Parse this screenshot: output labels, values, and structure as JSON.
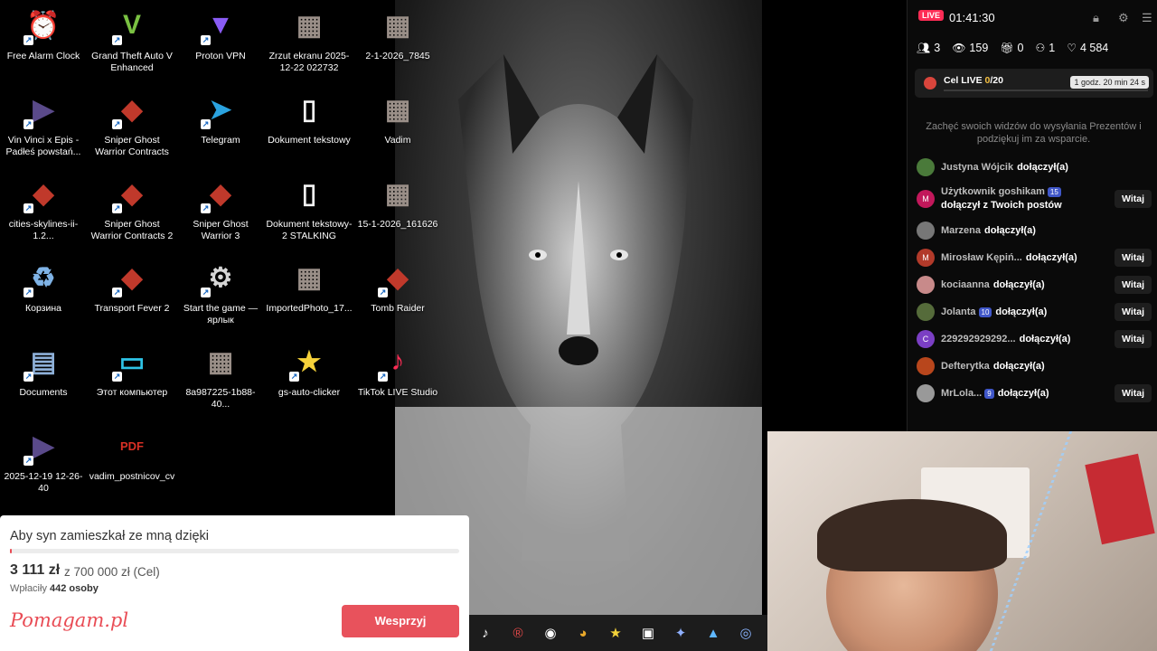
{
  "desktop": {
    "icons": [
      {
        "label": "Free Alarm Clock",
        "icon": "alarm-clock-icon"
      },
      {
        "label": "Grand Theft Auto V Enhanced",
        "icon": "gta-icon"
      },
      {
        "label": "Proton VPN",
        "icon": "vpn-icon"
      },
      {
        "label": "Zrzut ekranu 2025-12-22 022732",
        "icon": "image-icon"
      },
      {
        "label": "2-1-2026_7845",
        "icon": "image-icon"
      },
      {
        "label": "Vin Vinci x Epis - Padłeś powstań...",
        "icon": "video-icon"
      },
      {
        "label": "Sniper Ghost Warrior Contracts",
        "icon": "game-icon"
      },
      {
        "label": "Telegram",
        "icon": "telegram-icon"
      },
      {
        "label": "Dokument tekstowy",
        "icon": "document-icon"
      },
      {
        "label": "Vadim",
        "icon": "image-icon"
      },
      {
        "label": "cities-skylines-ii-1.2...",
        "icon": "game-icon"
      },
      {
        "label": "Sniper Ghost Warrior Contracts 2",
        "icon": "game-icon"
      },
      {
        "label": "Sniper Ghost Warrior 3",
        "icon": "game-icon"
      },
      {
        "label": "Dokument tekstowy-2 STALKING",
        "icon": "document-icon"
      },
      {
        "label": "15-1-2026_161626",
        "icon": "image-icon"
      },
      {
        "label": "Корзина",
        "icon": "recycle-bin-icon"
      },
      {
        "label": "Transport Fever 2",
        "icon": "game-icon"
      },
      {
        "label": "Start the game — ярлык",
        "icon": "shortcut-icon"
      },
      {
        "label": "ImportedPhoto_17...",
        "icon": "image-icon"
      },
      {
        "label": "Tomb Raider",
        "icon": "game-icon"
      },
      {
        "label": "Documents",
        "icon": "folder-icon"
      },
      {
        "label": "Этот компьютер",
        "icon": "computer-icon"
      },
      {
        "label": "8a987225-1b88-40...",
        "icon": "image-icon"
      },
      {
        "label": "gs-auto-clicker",
        "icon": "star-icon"
      },
      {
        "label": "TikTok LIVE Studio",
        "icon": "tiktok-icon"
      },
      {
        "label": "2025-12-19 12-26-40",
        "icon": "video-icon"
      },
      {
        "label": "vadim_postnicov_cv",
        "icon": "pdf-icon"
      }
    ]
  },
  "fundraiser": {
    "title": "Aby syn zamieszkał ze mną dzięki",
    "amount": "3 111 zł",
    "goal": "z 700 000 zł (Cel)",
    "payers_prefix": "Wpłaciły",
    "payers_count": "442 osoby",
    "logo": "Pomagam.pl",
    "button": "Wesprzyj",
    "progress": 0.0044,
    "accent": "#e8525c"
  },
  "live": {
    "badge": "LIVE",
    "timer": "01:41:30",
    "stats": {
      "guests": "3",
      "viewers": "159",
      "gifts": "0",
      "follows": "1",
      "likes": "4 584"
    },
    "goal": {
      "label": "Cel LIVE",
      "current": "0",
      "target": "/20",
      "time": "1 godz. 20 min 24 s"
    },
    "hint": "Zachęć swoich widzów do wysyłania Prezentów i podziękuj im za wsparcie.",
    "feed": [
      {
        "user": "Justyna Wójcik",
        "action": "dołączył(a)",
        "level": "",
        "witaj": "",
        "color": "#4a7a3a",
        "initial": ""
      },
      {
        "user": "Użytkownik goshikam",
        "action": "dołączył z Twoich postów",
        "level": "15",
        "witaj": "Witaj",
        "color": "#c2185b",
        "initial": "M"
      },
      {
        "user": "Marzena",
        "action": "dołączył(a)",
        "level": "",
        "witaj": "",
        "color": "#777",
        "initial": ""
      },
      {
        "user": "Mirosław Kępiń...",
        "action": "dołączył(a)",
        "level": "",
        "witaj": "Witaj",
        "color": "#b23a2a",
        "initial": "M"
      },
      {
        "user": "kociaanna",
        "action": "dołączył(a)",
        "level": "",
        "witaj": "Witaj",
        "color": "#c88a8a",
        "initial": ""
      },
      {
        "user": "Jolanta",
        "action": "dołączył(a)",
        "level": "10",
        "witaj": "Witaj",
        "color": "#556b3a",
        "initial": ""
      },
      {
        "user": "229292929292...",
        "action": "dołączył(a)",
        "level": "",
        "witaj": "Witaj",
        "color": "#7b3fc4",
        "initial": "C"
      },
      {
        "user": "Defterytka",
        "action": "dołączył(a)",
        "level": "",
        "witaj": "",
        "color": "#b8461c",
        "initial": ""
      },
      {
        "user": "MrLola...",
        "action": "dołączył(a)",
        "level": "9",
        "witaj": "Witaj",
        "color": "#999",
        "initial": ""
      }
    ]
  }
}
